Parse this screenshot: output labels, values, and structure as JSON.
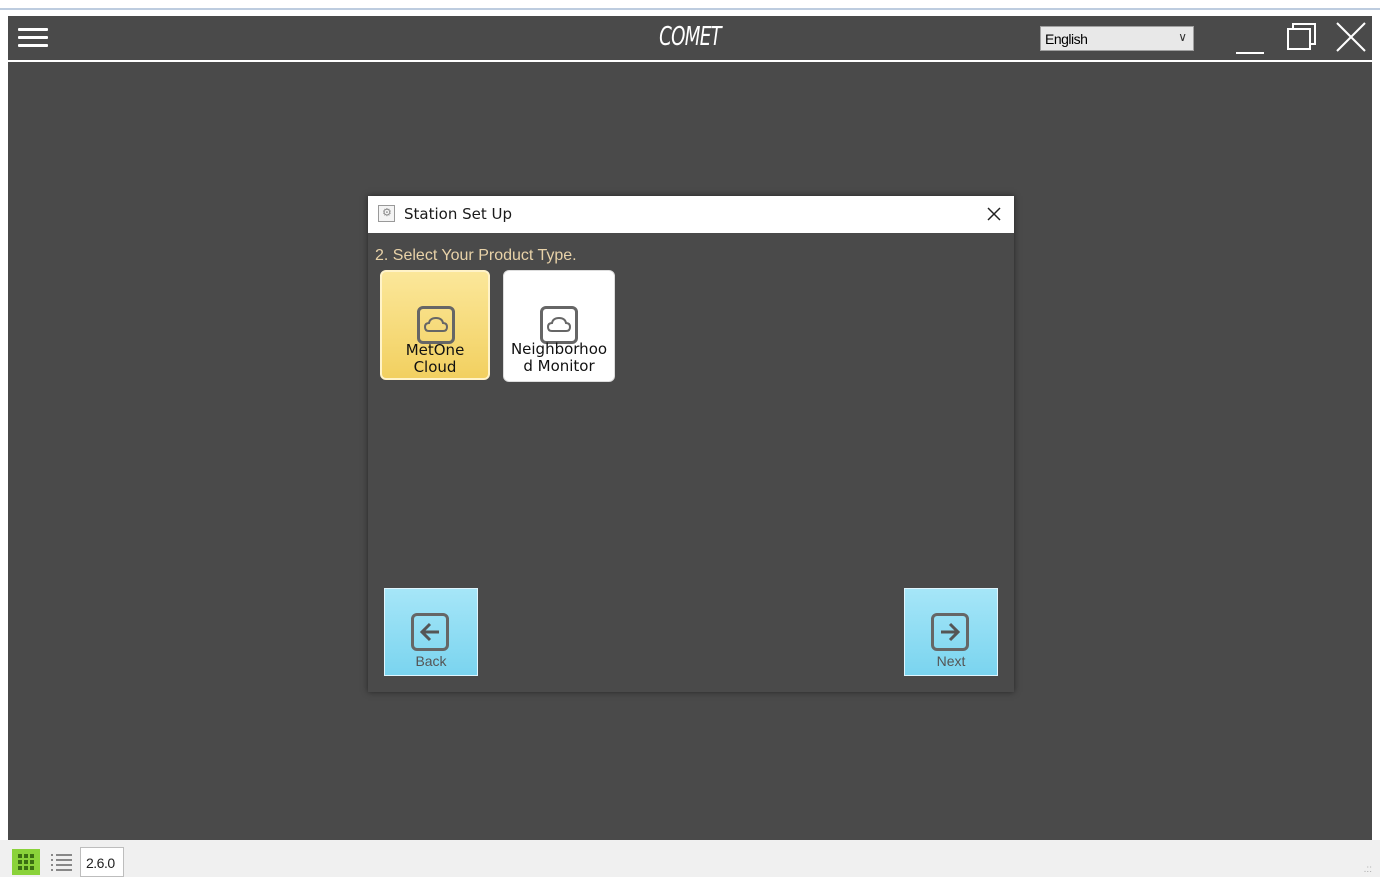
{
  "app": {
    "title": "COMET",
    "language": {
      "selected": "English"
    }
  },
  "dialog": {
    "title": "Station Set Up",
    "step_text": "2. Select Your Product Type.",
    "product_types": [
      {
        "line1": "MetOne",
        "line2": "Cloud",
        "icon": "cloud-icon",
        "selected": true
      },
      {
        "line1": "Neighborhoo",
        "line2": "d Monitor",
        "icon": "cloud-icon",
        "selected": false
      }
    ],
    "buttons": {
      "back": "Back",
      "next": "Next"
    }
  },
  "statusbar": {
    "version": "2.6.0"
  },
  "colors": {
    "background": "#4a4a4a",
    "selected_tile": "#f5d66a",
    "nav_button": "#8fdcf4",
    "grid_toggle_active": "#8ad23a",
    "step_text": "#e8d2a8"
  },
  "icons": {
    "menu": "hamburger-icon",
    "minimize": "minimize-icon",
    "maximize": "maximize-icon",
    "close": "close-icon",
    "back": "arrow-left-icon",
    "next": "arrow-right-icon",
    "grid_view": "grid-icon",
    "list_view": "list-icon",
    "settings": "gear-icon"
  }
}
